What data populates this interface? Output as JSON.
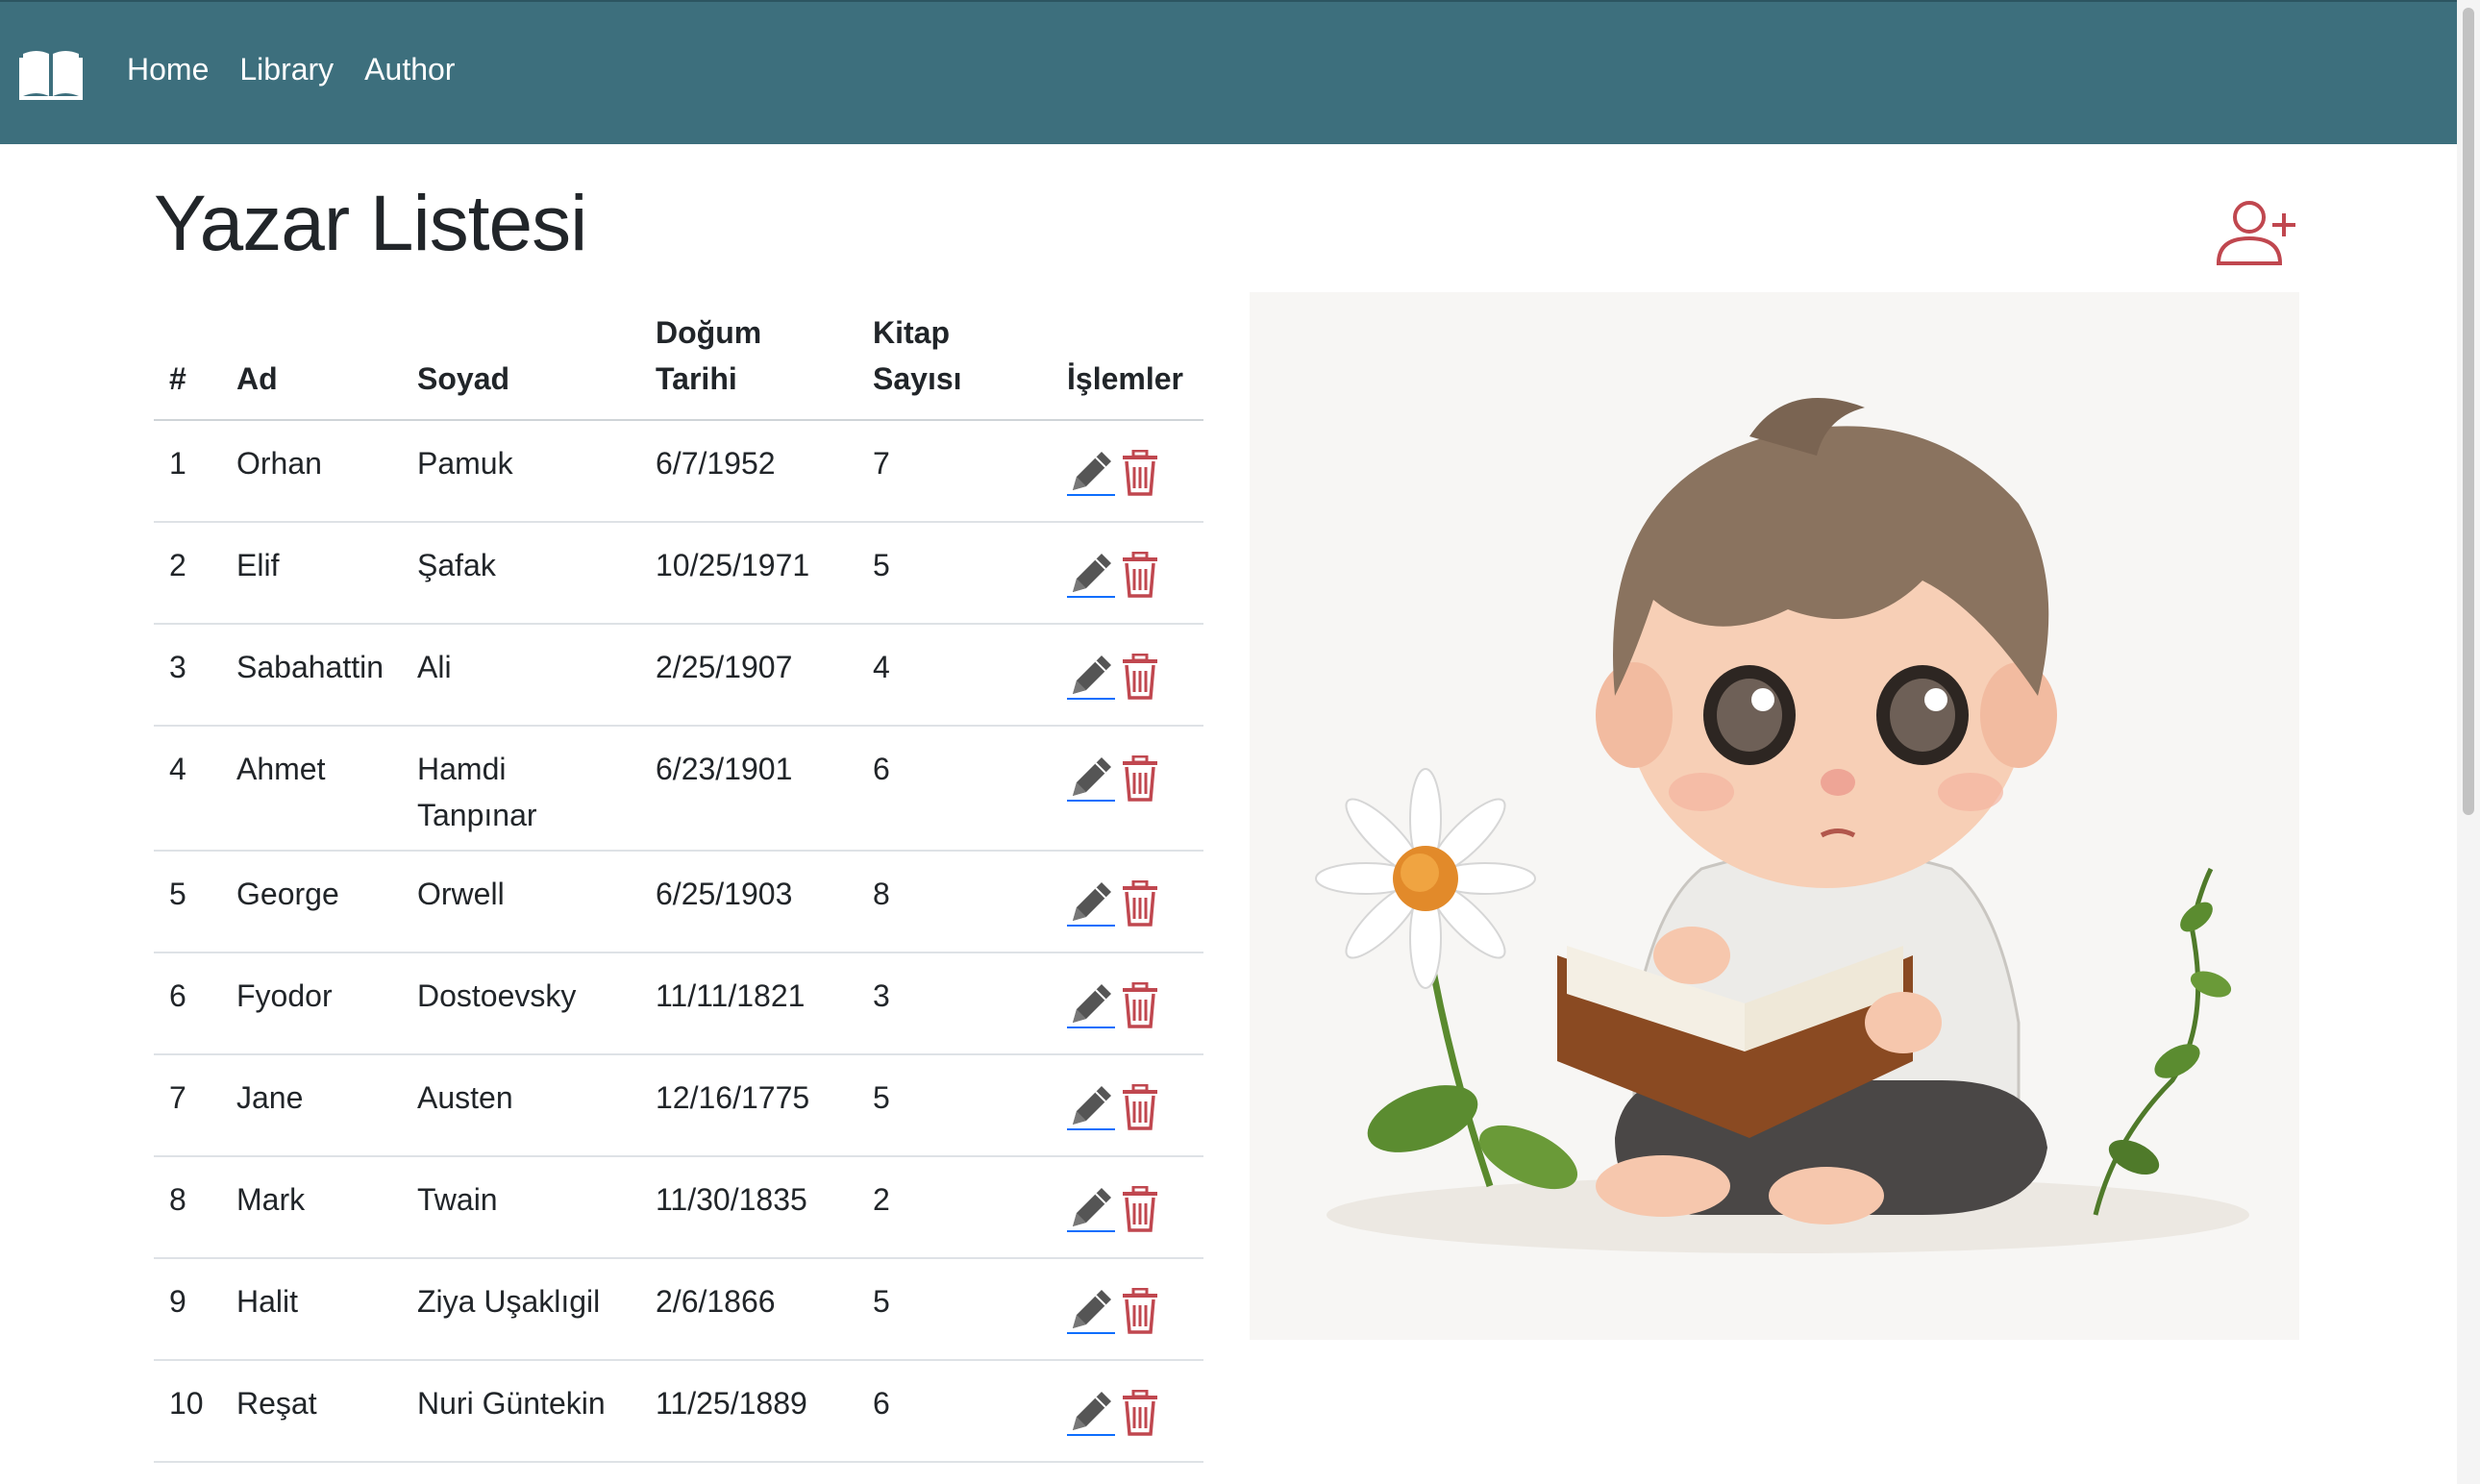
{
  "nav": {
    "brand_icon": "open-book-icon",
    "links": [
      "Home",
      "Library",
      "Author"
    ]
  },
  "page": {
    "title": "Yazar Listesi",
    "add_icon": "add-user-icon"
  },
  "table": {
    "headers": {
      "num": "#",
      "ad": "Ad",
      "soyad": "Soyad",
      "dogum_line1": "Doğum",
      "dogum_line2": "Tarihi",
      "kitap_line1": "Kitap",
      "kitap_line2": "Sayısı",
      "islemler": "İşlemler"
    },
    "rows": [
      {
        "num": "1",
        "ad": "Orhan",
        "soyad": "Pamuk",
        "dogum": "6/7/1952",
        "kitap": "7"
      },
      {
        "num": "2",
        "ad": "Elif",
        "soyad": "Şafak",
        "dogum": "10/25/1971",
        "kitap": "5"
      },
      {
        "num": "3",
        "ad": "Sabahattin",
        "soyad": "Ali",
        "dogum": "2/25/1907",
        "kitap": "4"
      },
      {
        "num": "4",
        "ad": "Ahmet",
        "soyad": "Hamdi Tanpınar",
        "dogum": "6/23/1901",
        "kitap": "6"
      },
      {
        "num": "5",
        "ad": "George",
        "soyad": "Orwell",
        "dogum": "6/25/1903",
        "kitap": "8"
      },
      {
        "num": "6",
        "ad": "Fyodor",
        "soyad": "Dostoevsky",
        "dogum": "11/11/1821",
        "kitap": "3"
      },
      {
        "num": "7",
        "ad": "Jane",
        "soyad": "Austen",
        "dogum": "12/16/1775",
        "kitap": "5"
      },
      {
        "num": "8",
        "ad": "Mark",
        "soyad": "Twain",
        "dogum": "11/30/1835",
        "kitap": "2"
      },
      {
        "num": "9",
        "ad": "Halit",
        "soyad": "Ziya Uşaklıgil",
        "dogum": "2/6/1866",
        "kitap": "5"
      },
      {
        "num": "10",
        "ad": "Reşat",
        "soyad": "Nuri Güntekin",
        "dogum": "11/25/1889",
        "kitap": "6"
      }
    ],
    "edit_icon": "pencil-icon",
    "delete_icon": "trash-icon"
  },
  "colors": {
    "navbar": "#3d6f7d",
    "delete": "#c0474f",
    "edit": "#555555",
    "link_underline": "#0d6efd"
  }
}
